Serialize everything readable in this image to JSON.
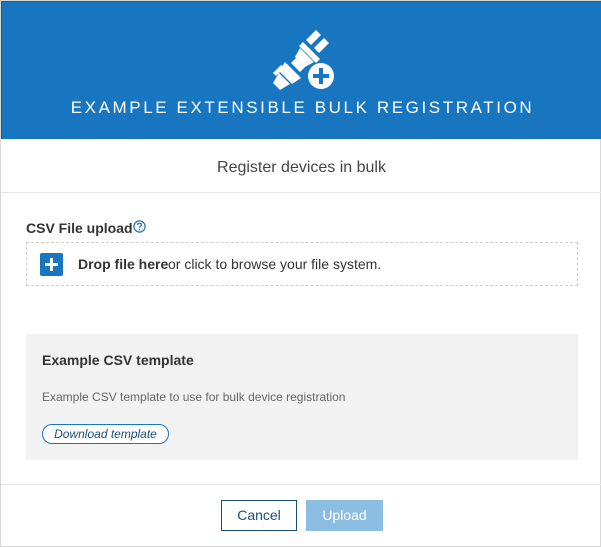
{
  "header": {
    "title": "EXAMPLE EXTENSIBLE BULK REGISTRATION",
    "icon": "plug-add-icon",
    "background_color": "#1776bf"
  },
  "subtitle": "Register devices in bulk",
  "upload": {
    "label": "CSV File upload",
    "help_icon": "question-circle-icon",
    "drop_strong": "Drop file here",
    "drop_rest": "or click to browse your file system."
  },
  "template": {
    "title": "Example CSV template",
    "description": "Example CSV template to use for bulk device registration",
    "download_label": "Download template"
  },
  "footer": {
    "cancel_label": "Cancel",
    "upload_label": "Upload",
    "upload_enabled": false
  }
}
